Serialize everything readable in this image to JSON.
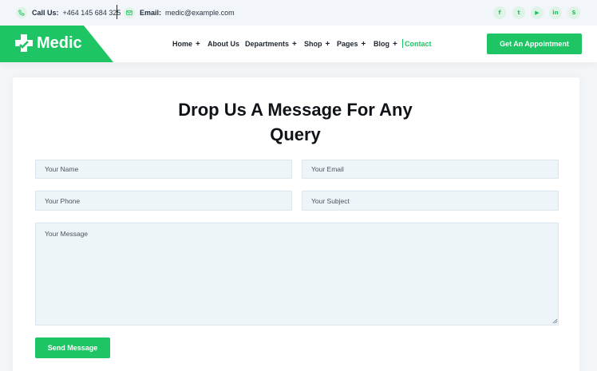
{
  "topbar": {
    "phone_label": "Call Us:",
    "phone_value": "+464 145 684 325",
    "email_label": "Email:",
    "email_value": "medic@example.com",
    "phone_icon": "phone-icon",
    "email_icon": "envelope-icon",
    "socials": [
      {
        "icon": "facebook-icon",
        "glyph": "f"
      },
      {
        "icon": "twitter-icon",
        "glyph": "t"
      },
      {
        "icon": "youtube-icon",
        "glyph": "▶"
      },
      {
        "icon": "linkedin-icon",
        "glyph": "in"
      },
      {
        "icon": "skype-icon",
        "glyph": "S"
      }
    ]
  },
  "header": {
    "logo_text": "Medic",
    "nav": [
      {
        "label": "Home",
        "has_submenu": true
      },
      {
        "label": "About Us",
        "has_submenu": false
      },
      {
        "label": "Departments",
        "has_submenu": true
      },
      {
        "label": "Shop",
        "has_submenu": true
      },
      {
        "label": "Pages",
        "has_submenu": true
      },
      {
        "label": "Blog",
        "has_submenu": true
      },
      {
        "label": "Contact",
        "has_submenu": false,
        "active": true
      }
    ],
    "plus_glyph": "+",
    "cta_label": "Get An Appointment"
  },
  "form": {
    "title_line1": "Drop Us A Message For Any",
    "title_line2": "Query",
    "name_placeholder": "Your Name",
    "email_placeholder": "Your Email",
    "phone_placeholder": "Your Phone",
    "subject_placeholder": "Your Subject",
    "message_placeholder": "Your Message",
    "submit_label": "Send Message"
  },
  "colors": {
    "accent": "#1fc564",
    "accent_light": "#dff3e6",
    "field_bg": "#eef5f9",
    "page_bg": "#f3f6f9"
  }
}
